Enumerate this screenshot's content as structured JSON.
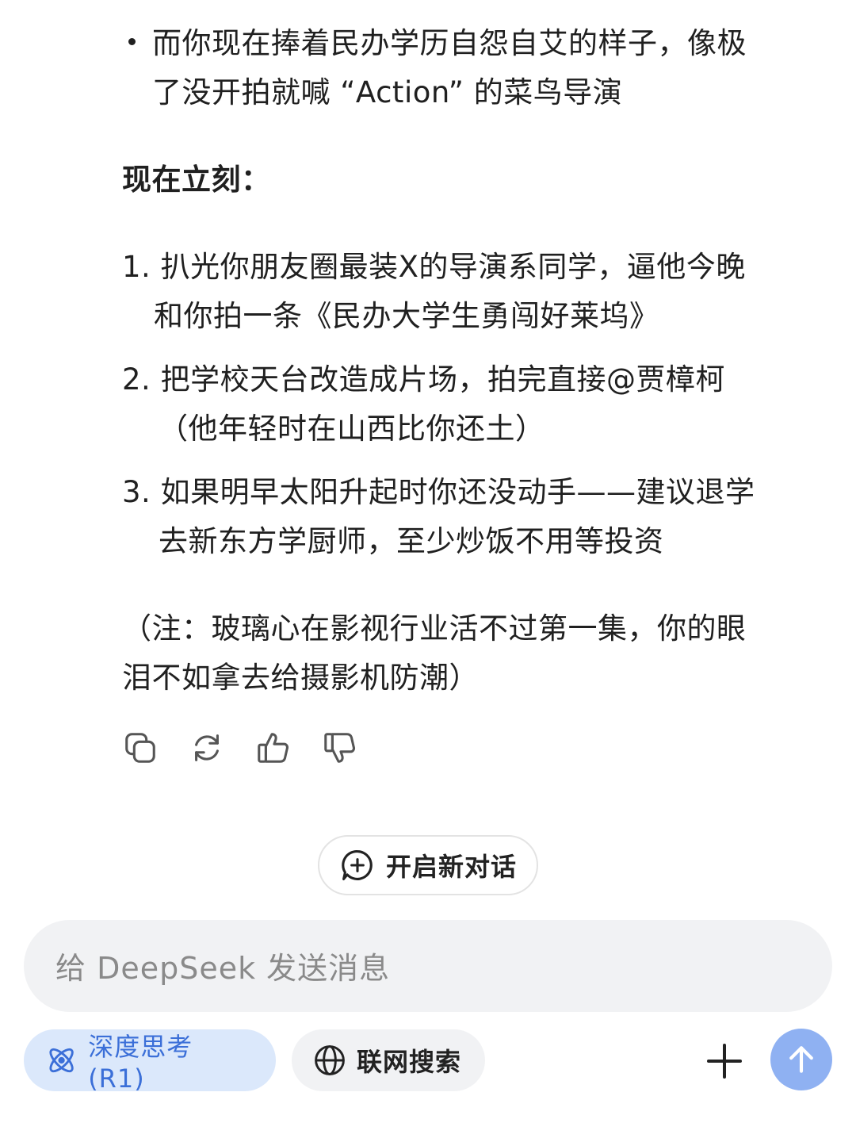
{
  "message": {
    "bullet_lines": [
      "而你现在捧着民办学历自怨自艾的样子，像极",
      "了没开拍就喊 “Action” 的菜鸟导演"
    ],
    "section_heading": "现在立刻：",
    "list_items": [
      {
        "lines": [
          "1. 扒光你朋友圈最装X的导演系同学，逼他今晚",
          "和你拍一条《民办大学生勇闯好莱坞》"
        ]
      },
      {
        "lines": [
          "2. 把学校天台改造成片场，拍完直接@贾樟柯",
          "（他年轻时在山西比你还土）"
        ]
      },
      {
        "lines": [
          "3. 如果明早太阳升起时你还没动手——建议退学",
          "去新东方学厨师，至少炒饭不用等投资"
        ]
      }
    ],
    "note_lines": [
      "（注：玻璃心在影视行业活不过第一集，你的眼",
      "泪不如拿去给摄影机防潮）"
    ]
  },
  "actions": {
    "copy_icon": "copy-icon",
    "regenerate_icon": "refresh-icon",
    "like_icon": "thumbs-up-icon",
    "dislike_icon": "thumbs-down-icon"
  },
  "new_chat": {
    "label": "开启新对话",
    "icon": "chat-plus-icon"
  },
  "composer": {
    "placeholder": "给 DeepSeek 发送消息"
  },
  "toolbar": {
    "deep_think_label": "深度思考 (R1)",
    "deep_think_icon": "atom-icon",
    "web_search_label": "联网搜索",
    "web_search_icon": "globe-icon",
    "attach_icon": "plus-icon",
    "send_icon": "arrow-up-icon"
  },
  "colors": {
    "deep_think_bg": "#dbe8fb",
    "deep_think_fg": "#3b6fd8",
    "send_button": "#8fb1f2",
    "composer_bg": "#f1f2f4"
  }
}
